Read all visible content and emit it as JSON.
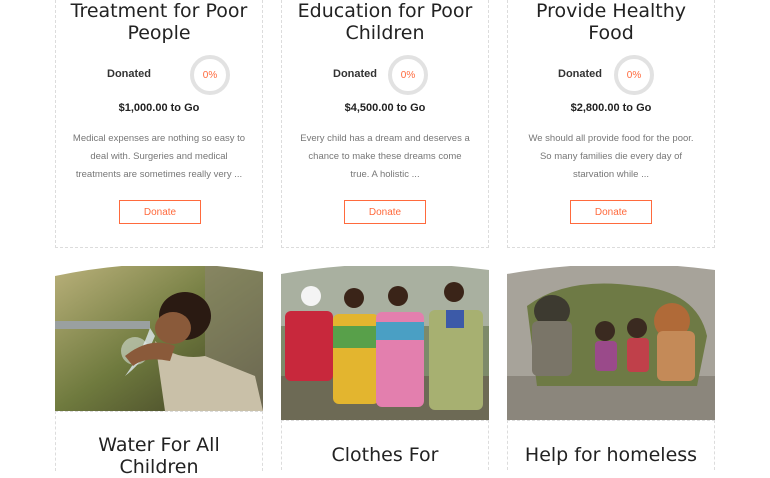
{
  "causes_top": [
    {
      "title": "Treatment for Poor People",
      "donated_label": "Donated",
      "percent": "0%",
      "to_go": "$1,000.00 to Go",
      "description": "Medical expenses are nothing so easy to deal with. Surgeries and medical treatments are sometimes really very ...",
      "button": "Donate"
    },
    {
      "title": "Education for Poor Children",
      "donated_label": "Donated",
      "percent": "0%",
      "to_go": "$4,500.00 to Go",
      "description": "Every child has a dream and deserves a chance to make these dreams come true. A holistic ...",
      "button": "Donate"
    },
    {
      "title": "Provide Healthy Food",
      "donated_label": "Donated",
      "percent": "0%",
      "to_go": "$2,800.00 to Go",
      "description": "We should all provide food for the poor. So many families die every day of starvation while ...",
      "button": "Donate"
    }
  ],
  "causes_bottom": [
    {
      "title": "Water For All Children"
    },
    {
      "title": "Clothes For"
    },
    {
      "title": "Help for homeless"
    }
  ],
  "colors": {
    "accent": "#ff6a3d",
    "ring": "#e2e2e2",
    "border": "#dcdcdc"
  }
}
